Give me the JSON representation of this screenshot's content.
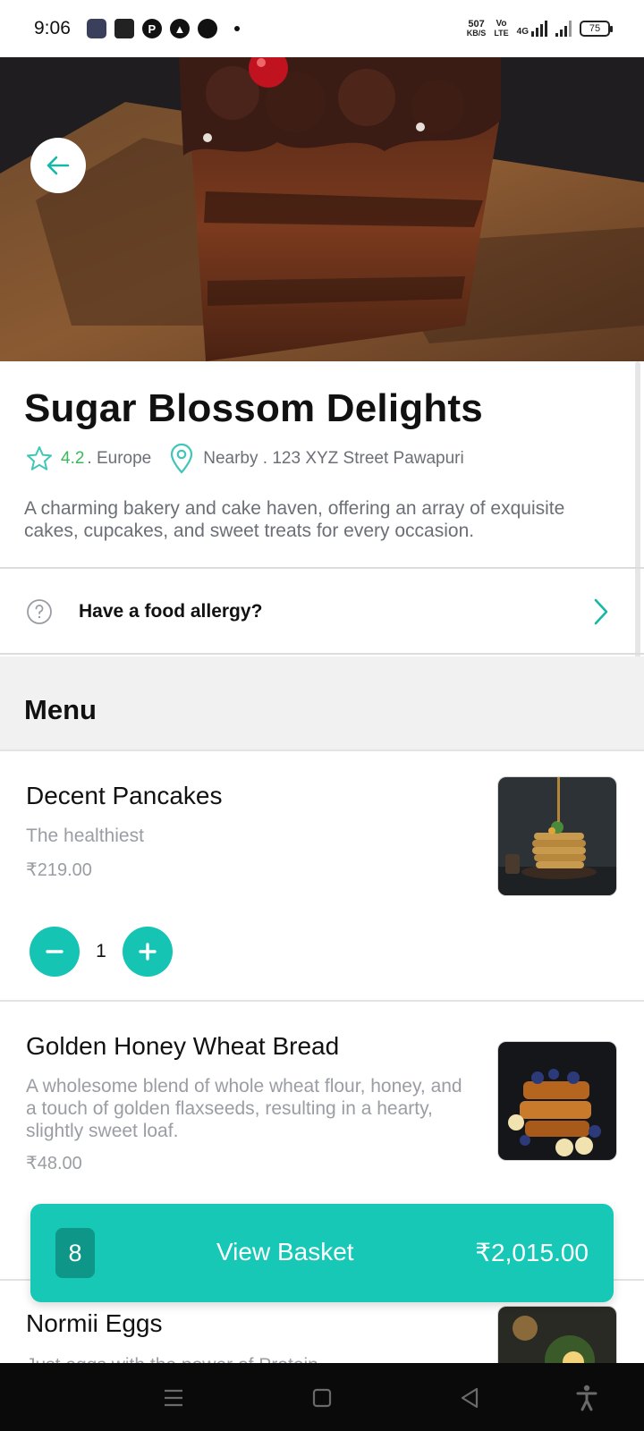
{
  "status_bar": {
    "time": "9:06",
    "net_speed_value": "507",
    "net_speed_unit": "KB/S",
    "volte_top": "Vo",
    "volte_bottom": "LTE",
    "network": "4G",
    "battery": "75"
  },
  "restaurant": {
    "name": "Sugar Blossom Delights",
    "rating": "4.2",
    "region": ". Europe",
    "location": "Nearby . 123 XYZ Street Pawapuri",
    "description": "A charming bakery and cake haven, offering an array of exquisite cakes, cupcakes, and sweet treats for every occasion."
  },
  "allergy": {
    "label": "Have a food allergy?"
  },
  "menu": {
    "title": "Menu",
    "items": [
      {
        "name": "Decent Pancakes",
        "description": "The healthiest",
        "price": "₹219.00",
        "quantity": "1"
      },
      {
        "name": "Golden Honey Wheat Bread",
        "description": "A wholesome blend of whole wheat flour, honey, and a touch of golden flaxseeds, resulting in a hearty, slightly sweet loaf.",
        "price": "₹48.00"
      },
      {
        "name": "Normii Eggs",
        "description": "Just eggs with the power of Protein"
      }
    ]
  },
  "basket": {
    "count": "8",
    "label": "View Basket",
    "total": "₹2,015.00"
  },
  "colors": {
    "accent": "#16c8b5",
    "accent_dark": "#0e9788",
    "rating_green": "#3bb85b"
  },
  "icons": {
    "back": "arrow-left-icon",
    "rating": "star-icon",
    "location": "map-pin-icon",
    "allergy": "question-circle-icon",
    "chevron": "chevron-right-icon",
    "minus": "minus-icon",
    "plus": "plus-icon"
  }
}
